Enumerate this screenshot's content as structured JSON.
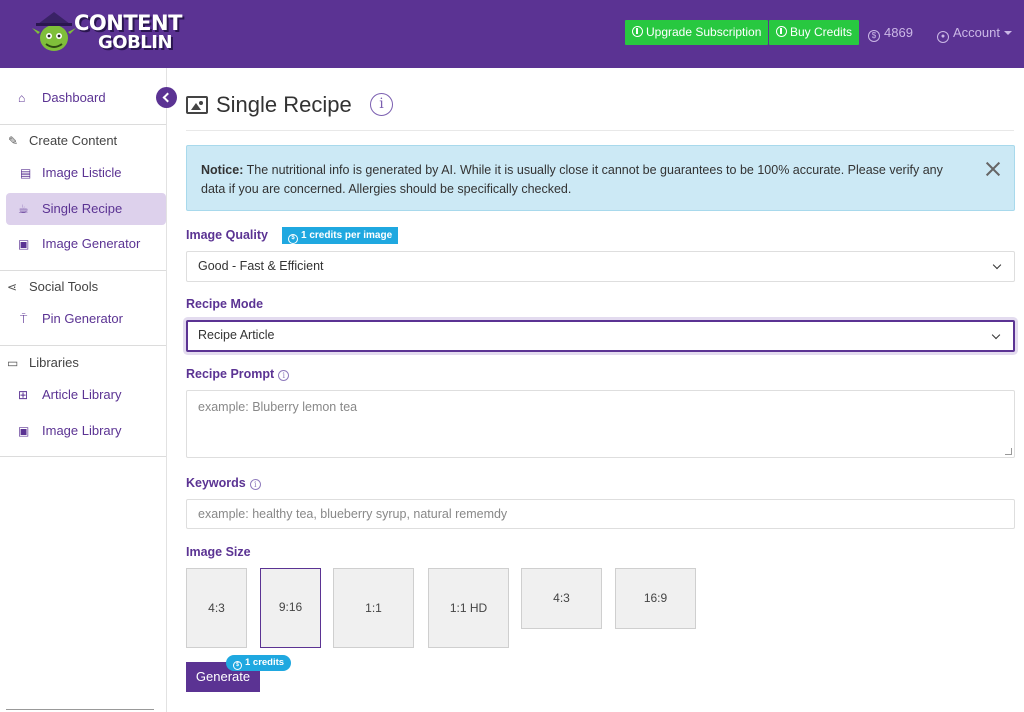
{
  "header": {
    "logo_line1": "CONTENT",
    "logo_line2": "GOBLIN",
    "upgrade_label": "Upgrade Subscription",
    "buy_credits_label": "Buy Credits",
    "credits_balance": "4869",
    "account_label": "Account",
    "colors": {
      "background": "#5b3393",
      "accent_green": "#28c840"
    }
  },
  "sidebar": {
    "dashboard": "Dashboard",
    "create_content": "Create Content",
    "image_listicle": "Image Listicle",
    "single_recipe": "Single Recipe",
    "image_generator": "Image Generator",
    "social_tools": "Social Tools",
    "pin_generator": "Pin Generator",
    "libraries": "Libraries",
    "article_library": "Article Library",
    "image_library": "Image Library",
    "active_item": "Single Recipe"
  },
  "page": {
    "title": "Single Recipe",
    "notice_label": "Notice:",
    "notice_text": " The nutritional info is generated by AI. While it is usually close it cannot be guarantees to be 100% accurate. Please verify any data if you are concerned. Allergies should be specifically checked."
  },
  "form": {
    "image_quality_label": "Image Quality",
    "image_quality_badge": "1 credits per image",
    "image_quality_value": "Good - Fast & Efficient",
    "recipe_mode_label": "Recipe Mode",
    "recipe_mode_value": "Recipe Article",
    "recipe_prompt_label": "Recipe Prompt",
    "recipe_prompt_placeholder": "example: Bluberry lemon tea",
    "keywords_label": "Keywords",
    "keywords_placeholder": "example: healthy tea, blueberry syrup, natural rememdy",
    "image_size_label": "Image Size",
    "image_sizes": [
      "4:3",
      "9:16",
      "1:1",
      "1:1 HD",
      "4:3",
      "16:9"
    ],
    "selected_size": "9:16",
    "generate_label": "Generate",
    "generate_badge": "1 credits"
  }
}
